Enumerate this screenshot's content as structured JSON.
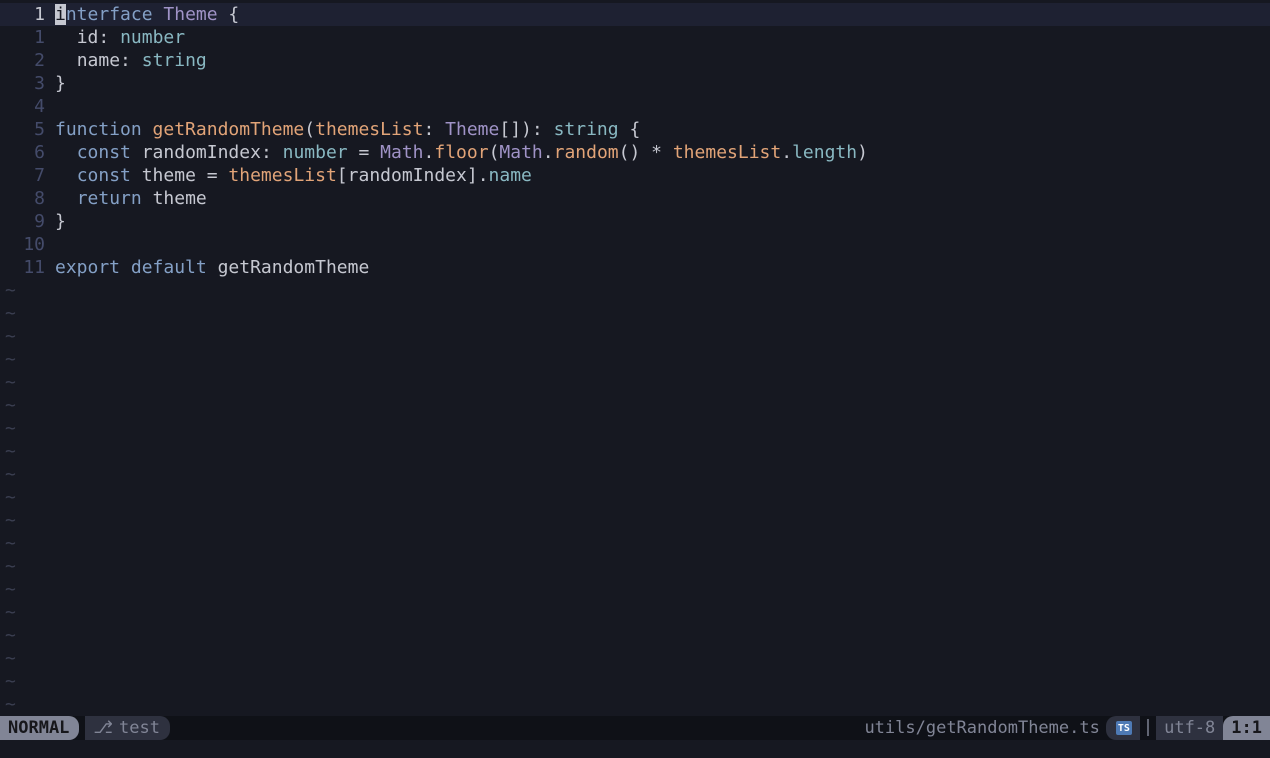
{
  "gutter": {
    "current": "1",
    "rel": [
      "1",
      "2",
      "3",
      "4",
      "5",
      "6",
      "7",
      "8",
      "9",
      "10",
      "11"
    ]
  },
  "code": {
    "l1": {
      "kw": "nterface",
      "cls": "Theme",
      "brace": " {",
      "cursor": "i"
    },
    "l2": {
      "indent": "  ",
      "id": "id",
      "colon": ": ",
      "ty": "number"
    },
    "l3": {
      "indent": "  ",
      "id": "name",
      "colon": ": ",
      "ty": "string"
    },
    "l4": {
      "brace": "}"
    },
    "l5": {
      "blank": ""
    },
    "l6": {
      "kw": "function",
      "sp": " ",
      "fn": "getRandomTheme",
      "lp": "(",
      "param": "themesList",
      "colon": ": ",
      "cls": "Theme",
      "arr": "[]",
      "rp": ")",
      "colon2": ": ",
      "ret": "string",
      "brace": " {"
    },
    "l7a": {
      "indent": "  ",
      "kw": "const",
      "sp": " ",
      "id": "randomIndex",
      "colon": ": ",
      "ty": "number",
      "eq": " = ",
      "cls": "Math",
      "dot": ".",
      "fn": "floor",
      "lp": "(",
      "cls2": "Math",
      "dot2": ".",
      "fn2": "random",
      "paren": "()",
      "mul": " * ",
      "param": "themesList",
      "dot3": ".",
      "prop": "length",
      "rp": ")"
    },
    "l8": {
      "indent": "  ",
      "kw": "const",
      "sp": " ",
      "id": "theme",
      "eq": " = ",
      "param": "themesList",
      "lb": "[",
      "idx": "randomIndex",
      "rb": "]",
      "dot": ".",
      "prop": "name"
    },
    "l9": {
      "indent": "  ",
      "kw": "return",
      "sp": " ",
      "id": "theme"
    },
    "l10": {
      "brace": "}"
    },
    "l11": {
      "blank": ""
    },
    "l12": {
      "kw": "export",
      "sp": " ",
      "kw2": "default",
      "sp2": " ",
      "id": "getRandomTheme"
    }
  },
  "status": {
    "mode": "NORMAL",
    "branch": "test",
    "branch_icon": "⎇",
    "file": "utils/getRandomTheme.ts",
    "filetype_icon": "TS",
    "encoding": "utf-8",
    "position": "1:1",
    "pipe": "|"
  },
  "tilde": "~"
}
